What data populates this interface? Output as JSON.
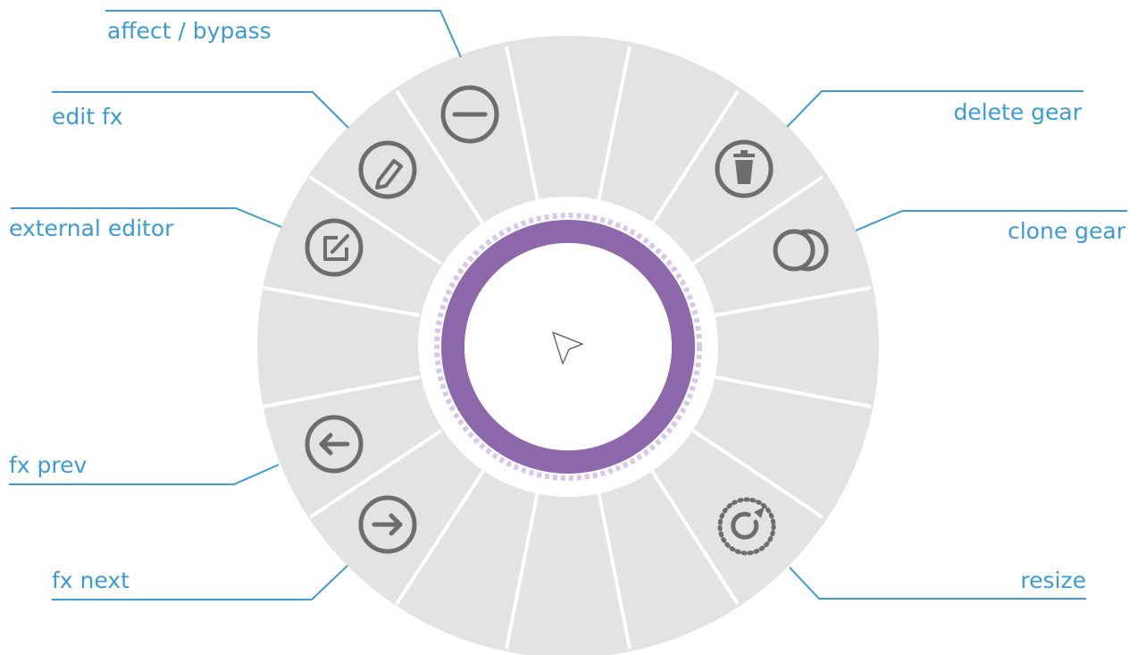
{
  "labels": {
    "affect_bypass": "affect / bypass",
    "edit_fx": "edit fx",
    "external_editor": "external editor",
    "fx_prev": "fx prev",
    "fx_next": "fx next",
    "delete_gear": "delete gear",
    "clone_gear": "clone gear",
    "resize": "resize"
  },
  "colors": {
    "segment": "#e3e3e3",
    "icon": "#6d6d6d",
    "accent": "#8d69ab",
    "accent_light": "#d8c7e8",
    "callout": "#3d9bd1"
  },
  "icons": {
    "center": "cursor-arrow-icon",
    "affect_bypass": "minus-circle-icon",
    "edit_fx": "pencil-circle-icon",
    "external_editor": "edit-square-icon",
    "fx_prev": "arrow-left-circle-icon",
    "fx_next": "arrow-right-circle-icon",
    "delete_gear": "trash-circle-icon",
    "clone_gear": "overlapping-circles-icon",
    "resize": "resize-dotted-icon"
  }
}
